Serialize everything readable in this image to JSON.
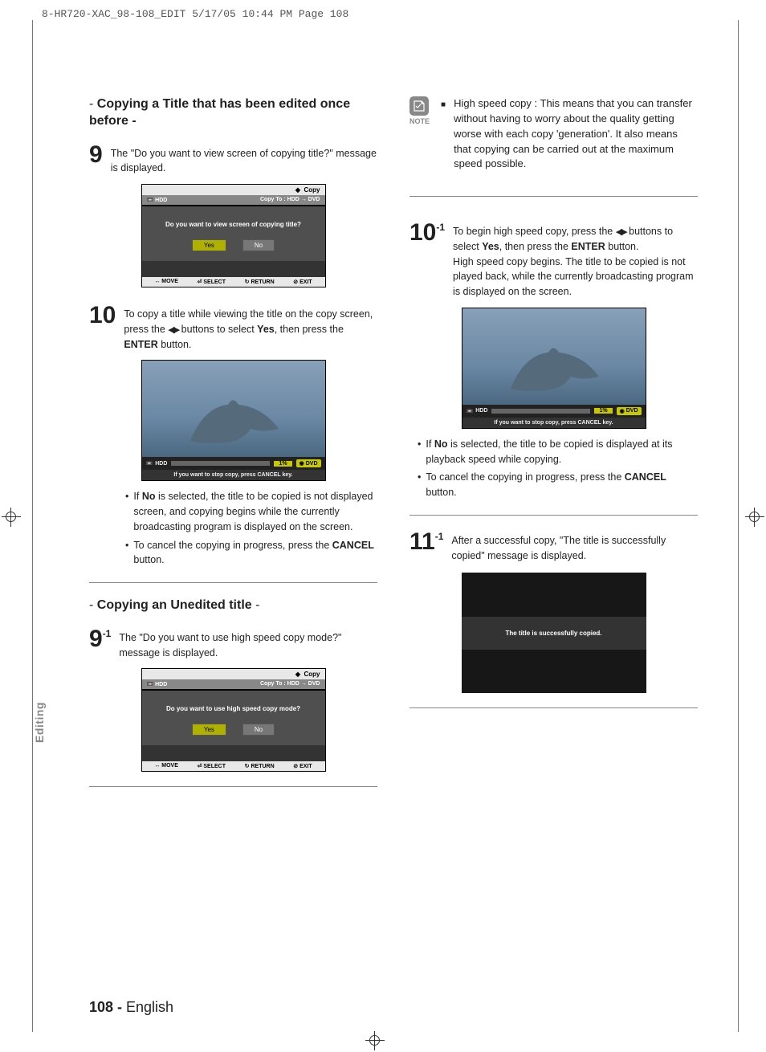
{
  "crop_header": "8-HR720-XAC_98-108_EDIT  5/17/05  10:44 PM  Page 108",
  "side_tab": "Editing",
  "page_footer": {
    "num": "108 - ",
    "lang": "English"
  },
  "left": {
    "title1_dash": "- ",
    "title1": "Copying a Title that has been edited once before -",
    "step9_num": "9",
    "step9_body_a": "The \"Do you want to view screen of copying title?\" message is displayed.",
    "step10_num": "10",
    "step10_body_a": "To copy a title while viewing the title on the copy screen, press the ",
    "step10_body_b": " buttons to select ",
    "step10_yes": "Yes",
    "step10_body_c": ", then press the ",
    "step10_enter": "ENTER",
    "step10_body_d": " button.",
    "bullet10_a_pre": "If ",
    "bullet10_a_no": "No",
    "bullet10_a_post": " is selected, the title to be copied is not displayed screen, and copying begins while the currently broadcasting program is displayed on the screen.",
    "bullet10_b_pre": "To cancel the copying in progress, press the ",
    "bullet10_b_cancel": "CANCEL",
    "bullet10_b_post": " button.",
    "title2_dash1": "- ",
    "title2": "Copying an Unedited title",
    "title2_dash2": " -",
    "step9_1_num": "9",
    "step9_1_sub": "-1",
    "step9_1_body": "The \"Do you want to use high speed copy mode?\" message is displayed."
  },
  "right": {
    "note_label": "NOTE",
    "note_text": "High speed copy : This means that you can transfer without having to worry about the quality getting worse with each copy 'generation'. It also means that copying can be carried out at the maximum speed possible.",
    "step10_1_num": "10",
    "step10_1_sub": "-1",
    "step10_1_a": "To begin high speed copy, press the ",
    "step10_1_b": " buttons to select ",
    "step10_1_yes": "Yes",
    "step10_1_c": ", then press the ",
    "step10_1_enter": "ENTER",
    "step10_1_d": " button.",
    "step10_1_e": "High speed copy begins. The title to be copied is not played back, while the currently broadcasting program is displayed on the screen.",
    "bullet10_1_a_pre": "If ",
    "bullet10_1_a_no": "No",
    "bullet10_1_a_post": " is selected, the title to be copied is displayed at its playback speed while copying.",
    "bullet10_1_b_pre": "To cancel the copying in progress, press the ",
    "bullet10_1_b_cancel": "CANCEL",
    "bullet10_1_b_post": " button.",
    "step11_1_num": "11",
    "step11_1_sub": "-1",
    "step11_1_body": "After a successful copy, \"The title is successfully copied\" message is displayed."
  },
  "mock_dialog1": {
    "top": "Copy",
    "sub_left": "HDD",
    "sub_right": "Copy To : HDD → DVD",
    "question": "Do you want to view screen of copying title?",
    "yes": "Yes",
    "no": "No",
    "f_move": "MOVE",
    "f_select": "SELECT",
    "f_return": "RETURN",
    "f_exit": "EXIT"
  },
  "mock_dialog2": {
    "top": "Copy",
    "sub_left": "HDD",
    "sub_right": "Copy To : HDD → DVD",
    "question": "Do you want to use high speed copy mode?",
    "yes": "Yes",
    "no": "No",
    "f_move": "MOVE",
    "f_select": "SELECT",
    "f_return": "RETURN",
    "f_exit": "EXIT"
  },
  "mock_copy": {
    "hdd": "HDD",
    "pct": "1%",
    "dvd": "DVD",
    "cancel": "If you want to stop copy, press CANCEL key."
  },
  "mock_success": {
    "msg": "The title is successfully copied."
  }
}
